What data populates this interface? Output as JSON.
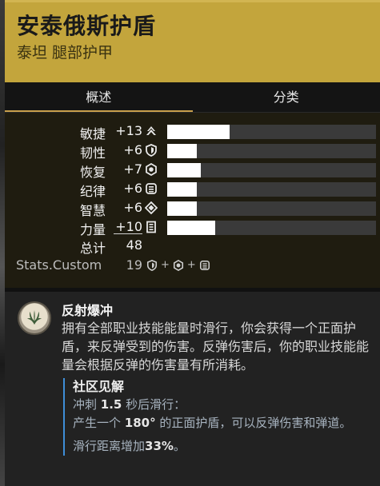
{
  "item": {
    "name": "安泰俄斯护盾",
    "subtitle": "泰坦 腿部护甲"
  },
  "tabs": [
    {
      "label": "概述",
      "active": true
    },
    {
      "label": "分类",
      "active": false
    }
  ],
  "stats": [
    {
      "label": "敏捷",
      "value": "+13",
      "icon": "mobility-icon",
      "fill_fraction": 0.3
    },
    {
      "label": "韧性",
      "value": "+6",
      "icon": "resilience-icon",
      "fill_fraction": 0.14
    },
    {
      "label": "恢复",
      "value": "+7",
      "icon": "recovery-icon",
      "fill_fraction": 0.16
    },
    {
      "label": "纪律",
      "value": "+6",
      "icon": "discipline-icon",
      "fill_fraction": 0.14
    },
    {
      "label": "智慧",
      "value": "+6",
      "icon": "intellect-icon",
      "fill_fraction": 0.14
    },
    {
      "label": "力量",
      "value": "+10",
      "icon": "strength-icon",
      "fill_fraction": 0.23
    }
  ],
  "total": {
    "label": "总计",
    "value": "48"
  },
  "custom": {
    "label": "Stats.Custom",
    "value": "19",
    "plus1": "+",
    "plus2": "+"
  },
  "perk": {
    "name": "反射爆冲",
    "description": "拥有全部职业技能能量时滑行，你会获得一个正面护盾，来反弹受到的伤害。反弹伤害后，你的职业技能能量会根据反弹的伤害量有所消耗。",
    "community": {
      "title": "社区见解",
      "line1_prefix": "冲刺 ",
      "line1_bold": "1.5",
      "line1_suffix": " 秒后滑行：",
      "line2_prefix": "产生一个 ",
      "line2_bold": "180°",
      "line2_suffix": " 的正面护盾，可以反弹伤害和弹道。",
      "line3_prefix": "滑行距离增加",
      "line3_bold": "33%",
      "line3_suffix": "。"
    }
  },
  "colors": {
    "header": "#c3a53c",
    "accent_tab": "#c9a04c",
    "community_bar": "#3e8ed8"
  }
}
